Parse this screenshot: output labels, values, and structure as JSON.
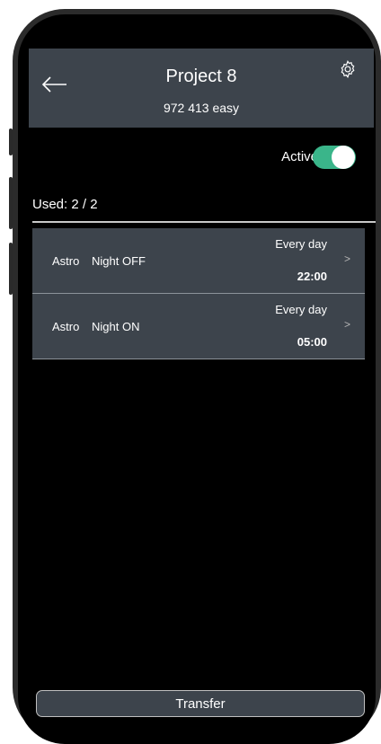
{
  "header": {
    "title": "Project 8",
    "subtitle": "972 413 easy",
    "back_icon": "arrow-left-icon",
    "settings_icon": "gear-icon"
  },
  "status": {
    "active_label": "Active",
    "active_on": true,
    "toggle_color": "#3ab58a"
  },
  "usage": {
    "label": "Used:",
    "value": "2 / 2"
  },
  "schedules": [
    {
      "type": "Astro",
      "name": "Night OFF",
      "days": "Every day",
      "time": "22:00"
    },
    {
      "type": "Astro",
      "name": "Night ON",
      "days": "Every day",
      "time": "05:00"
    }
  ],
  "footer": {
    "transfer_label": "Transfer"
  },
  "colors": {
    "panel": "#3d444c",
    "background": "#000000"
  }
}
